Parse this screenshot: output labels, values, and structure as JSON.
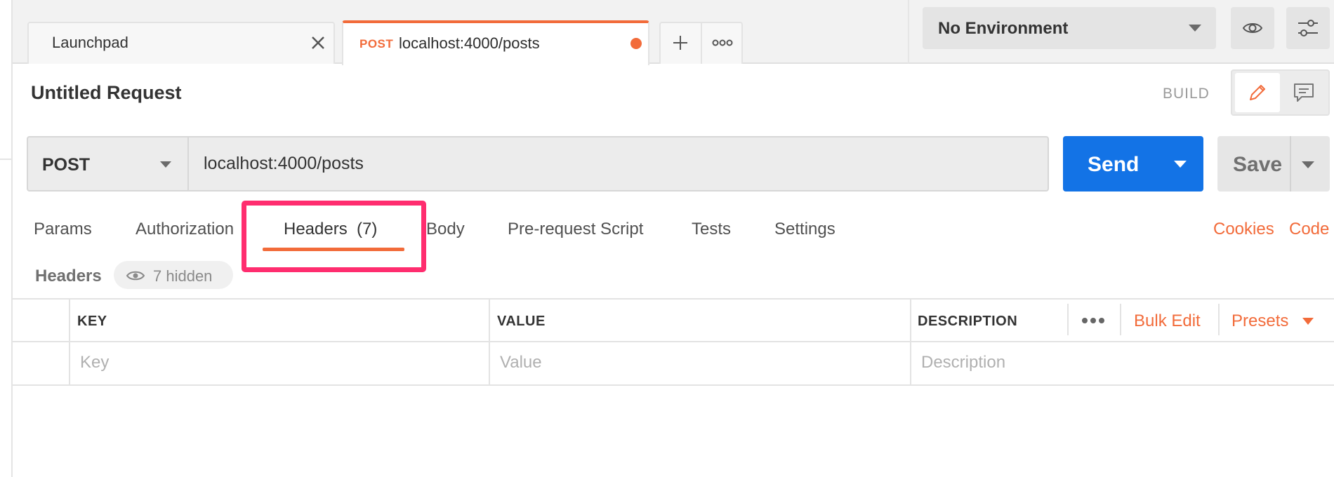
{
  "tabs": {
    "launchpad": {
      "label": "Launchpad"
    },
    "active": {
      "method": "POST",
      "url": "localhost:4000/posts"
    }
  },
  "environment": {
    "selected": "No Environment"
  },
  "request": {
    "title": "Untitled Request",
    "mode_label": "BUILD",
    "method": "POST",
    "url": "localhost:4000/posts",
    "send_label": "Send",
    "save_label": "Save"
  },
  "request_tabs": {
    "params": "Params",
    "authorization": "Authorization",
    "headers": "Headers",
    "headers_count": "(7)",
    "body": "Body",
    "prerequest": "Pre-request Script",
    "tests": "Tests",
    "settings": "Settings",
    "cookies": "Cookies",
    "code": "Code"
  },
  "headers_section": {
    "label": "Headers",
    "hidden": "7 hidden"
  },
  "table": {
    "columns": {
      "key": "KEY",
      "value": "VALUE",
      "description": "DESCRIPTION"
    },
    "bulk_edit": "Bulk Edit",
    "presets": "Presets",
    "placeholders": {
      "key": "Key",
      "value": "Value",
      "description": "Description"
    }
  },
  "colors": {
    "accent": "#f26b3a",
    "send": "#1373e6",
    "highlight": "#ff2d6f"
  },
  "icons": [
    "close-icon",
    "plus-icon",
    "more-icon",
    "chevron-down-icon",
    "eye-icon",
    "sliders-icon",
    "pencil-icon",
    "comment-icon"
  ]
}
